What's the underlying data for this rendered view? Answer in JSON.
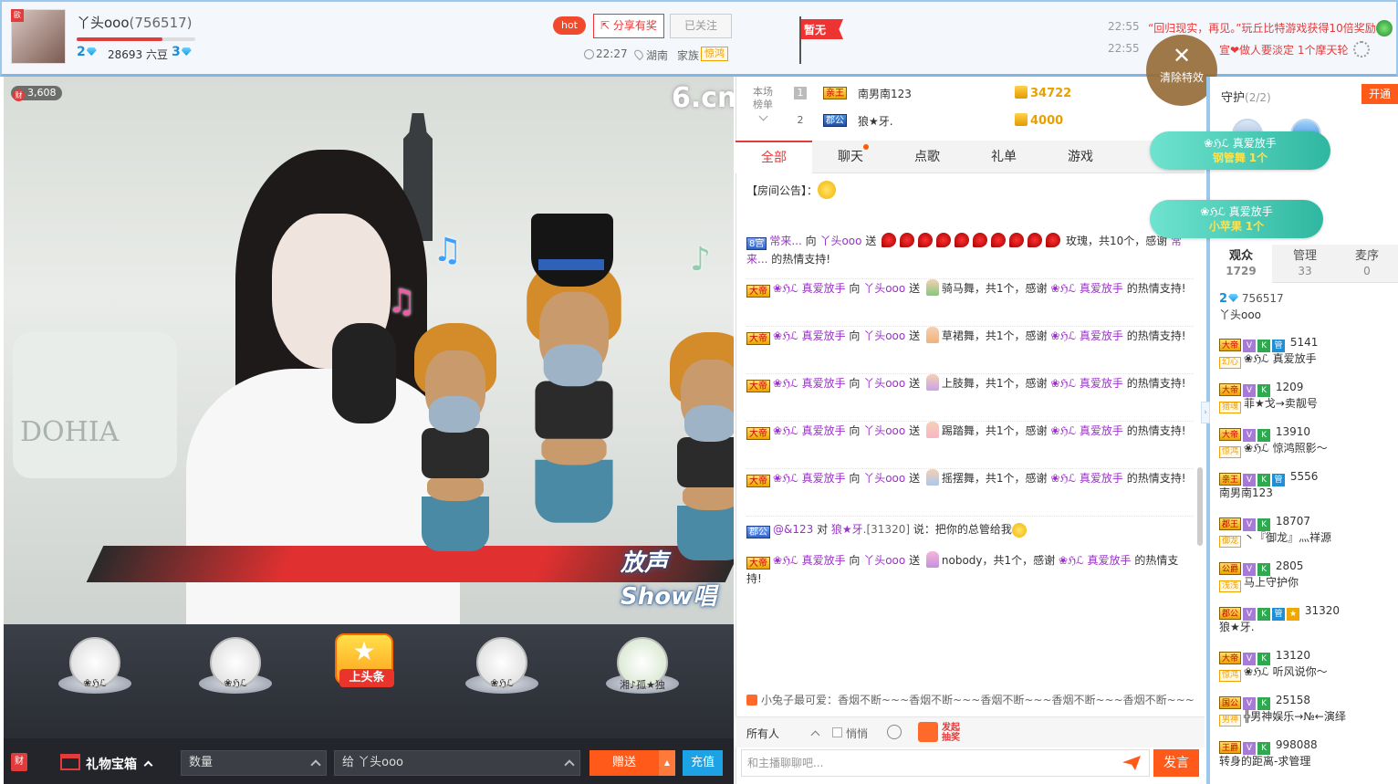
{
  "header": {
    "anchor_name": "丫头ooo",
    "anchor_room_id": "(756517)",
    "level_left": "2",
    "beans": "28693 六豆",
    "level_right": "3",
    "level_progress": 0.72,
    "hot_label": "hot",
    "share_label": "分享有奖",
    "follow_label": "已关注",
    "live_time": "22:27",
    "location": "湖南",
    "family_label": "家族",
    "family_tag": "惊鸿",
    "flag_label": "暂无",
    "news": [
      {
        "time": "22:55",
        "text": "“回归现实，再见。”玩丘比特游戏获得10倍奖励"
      },
      {
        "time": "22:55",
        "text": "宣❤做人要淡定 1个摩天轮"
      }
    ],
    "clear_effects_label": "清除特效",
    "avatar_badge": "歐"
  },
  "video": {
    "wealth_count": "3,608",
    "wealth_icon": "财",
    "site_logo": "6.cn",
    "show_logo": "放声Show唱",
    "pillow_text": "DOHIA"
  },
  "gift_bar": {
    "gifts": [
      {
        "label": "❀ℌℒ"
      },
      {
        "label": "❀ℌℒ"
      },
      {
        "label": "上头条"
      },
      {
        "label": "❀ℌℒ"
      },
      {
        "label": "湘♪孤★独"
      }
    ],
    "headline_top": "★"
  },
  "bottom_bar": {
    "cai": "财",
    "treasure_label": "礼物宝箱",
    "qty_placeholder": "数量",
    "to_label": "给 丫头ooo",
    "send_label": "赠送",
    "recharge_label": "充值"
  },
  "chat": {
    "rank_label": "本场榜单",
    "ranks": [
      {
        "num": "1",
        "title": "亲王",
        "name": "南男南123",
        "score": "34722"
      },
      {
        "num": "2",
        "title": "郡公",
        "name": "狼★牙.",
        "score": "4000"
      }
    ],
    "tabs": [
      "全部",
      "聊天",
      "点歌",
      "礼单",
      "游戏"
    ],
    "notice": "【房间公告】：",
    "messages": [
      {
        "tag": "8宫",
        "pre": "常来...",
        "mid": " 向 ",
        "to": "丫头ooo",
        "act": " 送 ",
        "gift": "",
        "post": " 玫瑰，共10个，感谢 ",
        "who": "常来...",
        "end": " 的热情支持!",
        "roses": 10
      },
      {
        "tag": "大帝",
        "pre": "❀ℌℒ 真爱放手",
        "mid": " 向 ",
        "to": "丫头ooo",
        "act": " 送 ",
        "gift": "骑马舞",
        "post": "，共1个，感谢 ",
        "who": "❀ℌℒ 真爱放手",
        "end": " 的热情支持!"
      },
      {
        "tag": "大帝",
        "pre": "❀ℌℒ 真爱放手",
        "mid": " 向 ",
        "to": "丫头ooo",
        "act": " 送 ",
        "gift": "草裙舞",
        "post": "，共1个，感谢 ",
        "who": "❀ℌℒ 真爱放手",
        "end": " 的热情支持!"
      },
      {
        "tag": "大帝",
        "pre": "❀ℌℒ 真爱放手",
        "mid": " 向 ",
        "to": "丫头ooo",
        "act": " 送 ",
        "gift": "上肢舞",
        "post": "，共1个，感谢 ",
        "who": "❀ℌℒ 真爱放手",
        "end": " 的热情支持!"
      },
      {
        "tag": "大帝",
        "pre": "❀ℌℒ 真爱放手",
        "mid": " 向 ",
        "to": "丫头ooo",
        "act": " 送 ",
        "gift": "踢踏舞",
        "post": "，共1个，感谢 ",
        "who": "❀ℌℒ 真爱放手",
        "end": " 的热情支持!"
      },
      {
        "tag": "大帝",
        "pre": "❀ℌℒ 真爱放手",
        "mid": " 向 ",
        "to": "丫头ooo",
        "act": " 送 ",
        "gift": "摇摆舞",
        "post": "，共1个，感谢 ",
        "who": "❀ℌℒ 真爱放手",
        "end": " 的热情支持!"
      }
    ],
    "talk": {
      "tag": "郡公",
      "user": "@&123",
      "to_word": " 对 ",
      "to": "狼★牙.",
      "room": "[31320]",
      "say": " 说：把你的总管给我"
    },
    "last_msg": {
      "tag": "大帝",
      "pre": "❀ℌℒ 真爱放手",
      "mid": " 向 ",
      "to": "丫头ooo",
      "act": " 送 ",
      "gift": "nobody",
      "post": "，共1个，感谢 ",
      "who": "❀ℌℒ 真爱放手",
      "end": " 的热情支持!"
    },
    "broadcast": "小兔子最可爱：香烟不断~~~香烟不断~~~香烟不断~~~香烟不断~~~香烟不断~~~",
    "target": "所有人",
    "private_label": "悄悄",
    "redpack_label_1": "发起",
    "redpack_label_2": "抽奖",
    "input_placeholder": "和主播聊聊吧...",
    "send_label": "发言"
  },
  "right": {
    "guard_label": "守护",
    "guard_count": "(2/2)",
    "open_label": "开通",
    "bubbles": [
      {
        "user": "❀ℌℒ 真爱放手",
        "gift": "钢管舞",
        "count": "1个"
      },
      {
        "user": "❀ℌℒ 真爱放手",
        "gift": "小苹果",
        "count": "1个"
      }
    ],
    "tabs": [
      {
        "label": "观众",
        "count": "1729"
      },
      {
        "label": "管理",
        "count": "33"
      },
      {
        "label": "麦序",
        "count": "0"
      }
    ],
    "anchor_entry": {
      "level": "2",
      "id": "756517",
      "name": "丫头ooo"
    },
    "users": [
      {
        "title": "大帝",
        "id": "5141",
        "fam": "幻心",
        "name": "❀ℌℒ 真爱放手",
        "g": true,
        "s": false
      },
      {
        "title": "大帝",
        "id": "1209",
        "fam": "猎魂",
        "name": "菲★戈→卖靓号",
        "g": false,
        "s": false
      },
      {
        "title": "大帝",
        "id": "13910",
        "fam": "惊鸿",
        "name": "❀ℌℒ 惊鸿照影～",
        "g": false,
        "s": false
      },
      {
        "title": "亲王",
        "id": "5556",
        "fam": "",
        "name": "南男南123",
        "g": true,
        "s": false
      },
      {
        "title": "郡王",
        "id": "18707",
        "fam": "御龙",
        "name": "丶『御龙』灬祥源",
        "g": false,
        "s": false
      },
      {
        "title": "公爵",
        "id": "2805",
        "fam": "浅浅",
        "name": "马上守护你",
        "g": false,
        "s": false
      },
      {
        "title": "郡公",
        "id": "31320",
        "fam": "",
        "name": "狼★牙.",
        "g": true,
        "s": true
      },
      {
        "title": "大帝",
        "id": "13120",
        "fam": "惊鸿",
        "name": "❀ℌℒ 听风说你～",
        "g": false,
        "s": false
      },
      {
        "title": "国公",
        "id": "25158",
        "fam": "男神",
        "name": "╬男神娱乐→№←演绎",
        "g": false,
        "s": false
      },
      {
        "title": "王爵",
        "id": "998088",
        "fam": "",
        "name": "转身的距离-求管理",
        "g": false,
        "s": false
      }
    ]
  },
  "colors": {
    "accent": "#e23b3b",
    "orange": "#ff5a1a",
    "blue": "#1ea2e6",
    "frame": "#9cc8ee"
  }
}
